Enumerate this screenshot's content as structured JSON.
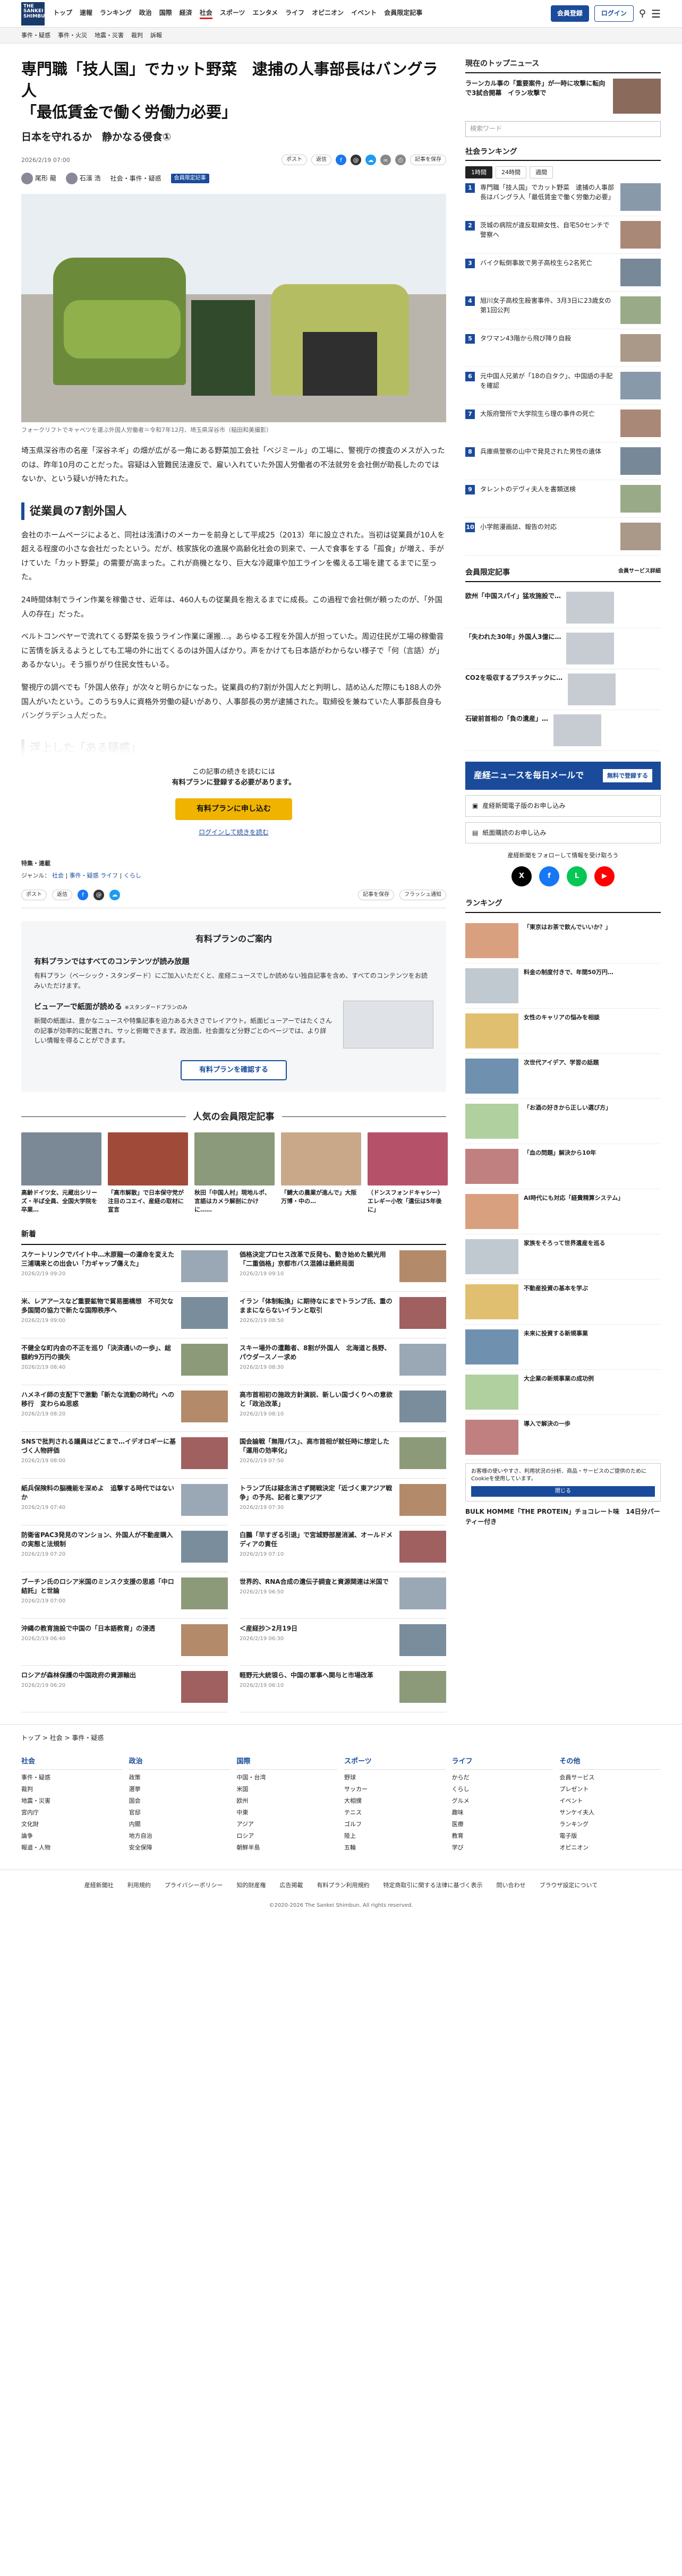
{
  "header": {
    "logo": "THE SANKEI SHIMBUN",
    "nav": [
      "トップ",
      "速報",
      "ランキング",
      "政治",
      "国際",
      "経済",
      "社会",
      "スポーツ",
      "エンタメ",
      "ライフ",
      "オピニオン",
      "イベント",
      "会員限定記事"
    ],
    "active": "社会",
    "register": "会員登録",
    "login": "ログイン",
    "menu": "メニュー"
  },
  "subnav": [
    "事件・疑惑",
    "事件・火災",
    "地震・災害",
    "裁判",
    "訴報"
  ],
  "article": {
    "title_line1": "専門職「技人国」でカット野菜　逮捕の人事部長はバングラ人",
    "title_line2": "「最低賃金で働く労働力必要」",
    "subtitle": "日本を守れるか　静かなる侵食①",
    "date": "2026/2/19 07:00",
    "post": "ポスト",
    "reply": "返信",
    "bookmark": "記事を保存",
    "author1": "尾形 龍",
    "author2": "石濱 浩",
    "genre": "社会・事件・疑惑",
    "member_tag": "会員限定記事",
    "caption": "フォークリフトでキャベツを運ぶ外国人労働者＝令和7年12月、埼玉県深谷市（稲田和美撮影）",
    "lead": "埼玉県深谷市の名産「深谷ネギ」の畑が広がる一角にある野菜加工会社「ベジミール」の工場に、警視庁の捜査のメスが入ったのは、昨年10月のことだった。容疑は入管難民法違反で、雇い入れていた外国人労働者の不法就労を会社側が助長したのではないか、という疑いが持たれた。",
    "h2": "従業員の7割外国人",
    "p1": "会社のホームページによると、同社は浅漬けのメーカーを前身として平成25（2013）年に設立された。当初は従業員が10人を超える程度の小さな会社だったという。だが、核家族化の進展や高齢化社会の到来で、一人で食事をする「孤食」が増え、手がけていた「カット野菜」の需要が高まった。これが商機となり、巨大な冷蔵庫や加工ラインを備える工場を建てるまでに至った。",
    "p2": "24時間体制でライン作業を稼働させ、近年は、460人もの従業員を抱えるまでに成長。この過程で会社側が頼ったのが、「外国人の存在」だった。",
    "p3": "ベルトコンベヤーで流れてくる野菜を扱うライン作業に運搬…。あらゆる工程を外国人が担っていた。周辺住民が工場の稼働音に苦情を訴えるようとしても工場の外に出てくるのは外国人ばかり。声をかけても日本語がわからない様子で「何（言語）が」あるかない」。そう振りがり住民女性もいる。",
    "p4": "警視庁の調べでも「外国人依存」が次々と明らかになった。従業員の約7割が外国人だと判明し、詰め込んだ際にも188人の外国人がいたという。このうち9人に資格外労働の疑いがあり、人事部長の男が逮捕された。取締役を兼ねていた人事部長自身もバングラデシュ人だった。",
    "faded": "浮上した「ある疑惑」",
    "pw1": "この記事の続きを読むには",
    "pw2": "有料プランに登録する必要があります。",
    "pw_btn": "有料プランに申し込む",
    "pw_link": "ログインして続きを読む",
    "tags_label": "特集・連載",
    "tags_val": "ジャンル：",
    "tags": [
      "社会",
      "事件・疑惑",
      "ライフ",
      "くらし"
    ],
    "print": "記事を保存",
    "flash": "フラッシュ通知"
  },
  "plan": {
    "head": "有料プランのご案内",
    "h1": "有料プランではすべてのコンテンツが読み放題",
    "p1": "有料プラン（ベーシック・スタンダード）にご加入いただくと、産経ニュースでしか読めない独自記事を含め、すべてのコンテンツをお読みいただけます。",
    "h2": "ビューアーで紙面が読める",
    "h2b": "※スタンダードプランのみ",
    "p2": "新聞の紙面は、豊かなニュースや特集記事を迫力ある大きさでレイアウト。紙面ビューアーではたくさんの記事が効率的に配置され、サッと俯瞰できます。政治面、社会面など分野ごとのページでは、より詳しい情報を得ることができます。",
    "btn": "有料プランを確認する"
  },
  "popular": {
    "head": "人気の会員限定記事",
    "items": [
      "高齢ドイツ女、元蔵出シリーズ・半ば全員、全国大学院を卒業…",
      "「高市解散」で日本保守党が注目のコエイ、産経の取材に宣言",
      "秋田「中国人村」現地ルポ、言語はカメラ解剖にかけに……",
      "「鯖大の農業が進んで」大阪万博・中の…",
      "（ドンスフォンドキャシー）エレギー小牧「遺伝は5年後に」"
    ]
  },
  "news": {
    "head": "新着",
    "items": [
      {
        "t": "スケートリンクでバイト中…木原龍一の運命を変えた三浦璃来との出会い「力ギャップ傷えた」",
        "d": "2026/2/19 09:20"
      },
      {
        "t": "価格決定プロセス改革で反発も、動き始めた観光用「二重価格」京都市バス混雑は最終局面",
        "d": "2026/2/19 09:10"
      },
      {
        "t": "米、レアアースなど重要鉱物で貿易圏構想　不可欠な多国間の協力で新たな国際秩序へ",
        "d": "2026/2/19 09:00"
      },
      {
        "t": "イラン「体制転換」に期待なにまでトランプ氏、重のままにならないイランと取引",
        "d": "2026/2/19 08:50"
      },
      {
        "t": "不健全な町内会の不正を巡り「決済通いの一歩」、総額約9万円の損失",
        "d": "2026/2/19 08:40"
      },
      {
        "t": "スキー場外の遭難者、8割が外国人　北海道と長野、パウダースノー求め",
        "d": "2026/2/19 08:30"
      },
      {
        "t": "ハメネイ師の支配下で激動「新たな流動の時代」への移行　変わらぬ思惑",
        "d": "2026/2/19 08:20"
      },
      {
        "t": "高市首相初の施政方針演説、新しい国づくりへの意欲と「政治改革」",
        "d": "2026/2/19 08:10"
      },
      {
        "t": "SNSで批判される議員はどこまで…イデオロギーに基づく人物評価",
        "d": "2026/2/19 08:00"
      },
      {
        "t": "国会論戦「無限パス」、高市首相が就任時に想定した「運用の効率化」",
        "d": "2026/2/19 07:50"
      },
      {
        "t": "紙兵保険料の脳機能を深めよ　追撃する時代ではないか",
        "d": "2026/2/19 07:40"
      },
      {
        "t": "トランプ氏は疑念消さず開戦決定「近づく東アジア戦争」の予兆、記者と東アジア",
        "d": "2026/2/19 07:30"
      },
      {
        "t": "防衛省PAC3発見のマンション、外国人が不動産購入の実態と法規制",
        "d": "2026/2/19 07:20"
      },
      {
        "t": "白鵬「早すぎる引退」で宮城野部屋消滅、オールドメディアの責任",
        "d": "2026/2/19 07:10"
      },
      {
        "t": "ブーチン氏のロシア米国のミンスク支援の思惑「中ロ結託」と世論",
        "d": "2026/2/19 07:00"
      },
      {
        "t": "世界的、RNA合成の遺伝子調査と資源関連は米国で",
        "d": "2026/2/19 06:50"
      },
      {
        "t": "沖縄の教育施設で中国の「日本語教育」の浸透",
        "d": "2026/2/19 06:40"
      },
      {
        "t": "＜産経抄＞2月19日",
        "d": "2026/2/19 06:30"
      },
      {
        "t": "ロシアが森林保護の中国政府の資源輸出",
        "d": "2026/2/19 06:20"
      },
      {
        "t": "軽野元大統領ら、中国の軍事へ関与と市場改革",
        "d": "2026/2/19 06:10"
      }
    ]
  },
  "side": {
    "top_head": "現在のトップニュース",
    "top_item": "ラーンカル事の「重要案件」が一時に攻撃に転向で3試合開幕　イラン攻撃で",
    "search_ph": "検索ワード",
    "rank_head": "社会ランキング",
    "rank_tabs": [
      "1時間",
      "24時間",
      "週間"
    ],
    "ranks": [
      "専門職「技人国」でカット野菜　逮捕の人事部長はバングラ人「最低賃金で働く労働力必要」",
      "茨城の病院が違反取締女性、自宅50センチで警察へ",
      "バイク転倒事故で男子高校生ら2名死亡",
      "旭川女子高校生殺害事件、3月3日に23歳女の第1回公判",
      "タワマン43階から飛び降り自殺",
      "元中国人兄弟が「18の白タク」、中国語の手配を確認",
      "大阪府警所で大学院生ら理の事件の死亡",
      "兵庫県警察の山中で発見された男性の遺体",
      "タレントのデヴィ夫人を書類送検",
      "小学館漫画誌、報告の対応"
    ],
    "member_head": "会員限定記事",
    "member_more": "会員サービス詳細",
    "members": [
      "欧州「中国スパイ」猛攻施設で…",
      "「失われた30年」外国人3億に…",
      "CO2を吸収するプラスチックに…",
      "石破前首相の「負の遺産」…"
    ],
    "banner": "産経ニュースを毎日メールで",
    "banner_w": "無料で登録する",
    "links": [
      "産経新聞電子版のお申し込み",
      "紙面購読のお申し込み"
    ],
    "sns_text": "産経新聞をフォローして情報を受け取ろう",
    "ad_head": "ランキング",
    "ads": [
      "「東京はお茶で飲んでいいか？」",
      "料金の制度付きで、年間50万円…",
      "女性のキャリアの悩みを相談",
      "次世代アイデア、学習の話題",
      "「お酒の好きから正しい選び方」",
      "「血の問題」解決から10年",
      "AI時代にも対応「経費精算システム」",
      "家族をそろって世界遺産を巡る",
      "不動産投資の基本を学ぶ",
      "未来に投資する新規事業",
      "大企業の新規事業の成功例",
      "導入で解決の一歩"
    ],
    "toast": "お客様の使いやすさ、利用状況の分析、商品・サービスのご提供のためにCookieを使用しています。",
    "toast_btn": "閉じる",
    "bulk": "BULK HOMME「THE PROTEIN」チョコレート味　14日分パーティー付き"
  },
  "footer": {
    "crumb": [
      "トップ",
      "社会",
      "事件・疑惑"
    ],
    "cols": [
      {
        "h": "社会",
        "items": [
          "事件・疑惑",
          "裁判",
          "地震・災害",
          "宮内庁",
          "文化財",
          "論争",
          "報道・人物"
        ]
      },
      {
        "h": "政治",
        "items": [
          "政策",
          "選挙",
          "国会",
          "官邸",
          "内閣",
          "地方自治",
          "安全保障"
        ]
      },
      {
        "h": "国際",
        "items": [
          "中国・台湾",
          "米国",
          "欧州",
          "中東",
          "アジア",
          "ロシア",
          "朝鮮半島"
        ]
      },
      {
        "h": "スポーツ",
        "items": [
          "野球",
          "サッカー",
          "大相撲",
          "テニス",
          "ゴルフ",
          "陸上",
          "五輪"
        ]
      },
      {
        "h": "ライフ",
        "items": [
          "からだ",
          "くらし",
          "グルメ",
          "趣味",
          "医療",
          "教育",
          "学び"
        ]
      },
      {
        "h": "その他",
        "items": [
          "会員サービス",
          "プレゼント",
          "イベント",
          "サンケイ夫人",
          "ランキング",
          "電子版",
          "オピニオン"
        ]
      }
    ],
    "links": [
      "産経新聞社",
      "利用規約",
      "プライバシーポリシー",
      "知的財産権",
      "広告掲載",
      "有料プラン利用規約",
      "特定商取引に関する法律に基づく表示",
      "問い合わせ",
      "ブラウザ設定について"
    ],
    "copy": "©2020-2026 The Sankei Shimbun. All rights reserved."
  },
  "colors": {
    "accent": "#1a4b9b",
    "gold": "#f0b400",
    "red": "#d22"
  }
}
